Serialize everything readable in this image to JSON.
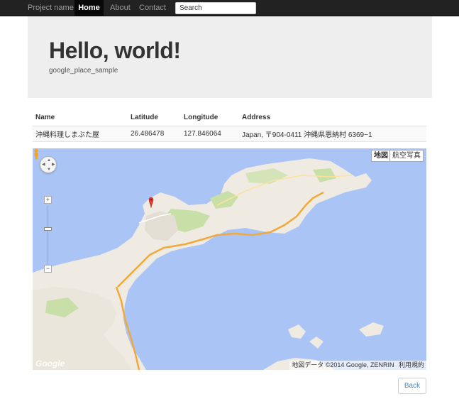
{
  "navbar": {
    "brand": "Project name",
    "items": [
      {
        "label": "Home",
        "active": true
      },
      {
        "label": "About",
        "active": false
      },
      {
        "label": "Contact",
        "active": false
      }
    ],
    "search_placeholder": "Search"
  },
  "jumbotron": {
    "title": "Hello, world!",
    "subtitle": "google_place_sample"
  },
  "table": {
    "headers": [
      "Name",
      "Latitude",
      "Longitude",
      "Address"
    ],
    "rows": [
      [
        "沖縄料理しまぶた屋",
        "26.486478",
        "127.846064",
        "Japan, 〒904-0411 沖縄県恩納村 6369−1"
      ]
    ]
  },
  "map": {
    "type_map_label": "地図",
    "type_satellite_label": "航空写真",
    "attribution": "地図データ ©2014 Google, ZENRIN",
    "terms_label": "利用規約",
    "logo": "Google",
    "colors": {
      "water": "#a9c4f5",
      "land": "#efebe2",
      "green": "#c8dfa8",
      "highway": "#f2a93b",
      "marker": "#e43c30"
    }
  },
  "footer": {
    "back_label": "Back"
  }
}
